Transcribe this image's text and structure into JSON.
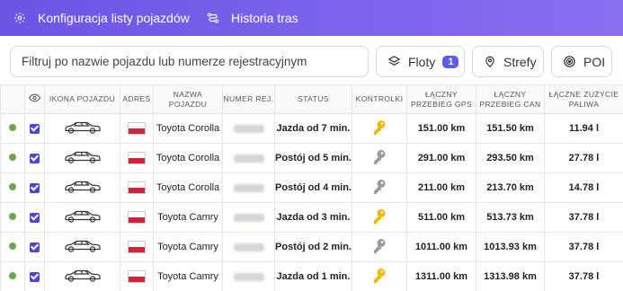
{
  "header": {
    "nav": [
      {
        "label": "Konfiguracja listy pojazdów",
        "icon": "gear-icon"
      },
      {
        "label": "Historia tras",
        "icon": "route-icon"
      }
    ]
  },
  "filters": {
    "search_placeholder": "Filtruj po nazwie pojazdu lub numerze rejestracyjnym",
    "fleets_label": "Floty",
    "fleets_count": "1",
    "zones_label": "Strefy",
    "poi_label": "POI"
  },
  "table": {
    "columns": [
      "",
      "",
      "Ikona pojazdu",
      "Adres",
      "Nazwa pojazdu",
      "Numer rej.",
      "Status",
      "Kontrolki",
      "Łączny przebieg GPS",
      "Łączny przebieg CAN",
      "Łączne zużycie paliwa"
    ],
    "rows": [
      {
        "name": "Toyota Corolla",
        "status": "Jazda od 7 min.",
        "key": "active",
        "gps": "151.00 km",
        "can": "151.50 km",
        "fuel": "11.94 l"
      },
      {
        "name": "Toyota Corolla",
        "status": "Postój od 5 min.",
        "key": "inactive",
        "gps": "291.00 km",
        "can": "293.50 km",
        "fuel": "27.78 l"
      },
      {
        "name": "Toyota Corolla",
        "status": "Postój od 4 min.",
        "key": "inactive",
        "gps": "211.00 km",
        "can": "213.70 km",
        "fuel": "14.78 l"
      },
      {
        "name": "Toyota Camry",
        "status": "Jazda od 3 min.",
        "key": "active",
        "gps": "511.00 km",
        "can": "513.73 km",
        "fuel": "37.78 l"
      },
      {
        "name": "Toyota Camry",
        "status": "Postój od 2 min.",
        "key": "inactive",
        "gps": "1011.00 km",
        "can": "1013.93 km",
        "fuel": "37.78 l"
      },
      {
        "name": "Toyota Camry",
        "status": "Jazda od 1 min.",
        "key": "active",
        "gps": "1311.00 km",
        "can": "1313.98 km",
        "fuel": "37.78 l"
      }
    ]
  },
  "colors": {
    "accent": "#5b5ce6",
    "online": "#6aa84f",
    "key_active": "#f2b705",
    "key_inactive": "#9a9a9a"
  }
}
